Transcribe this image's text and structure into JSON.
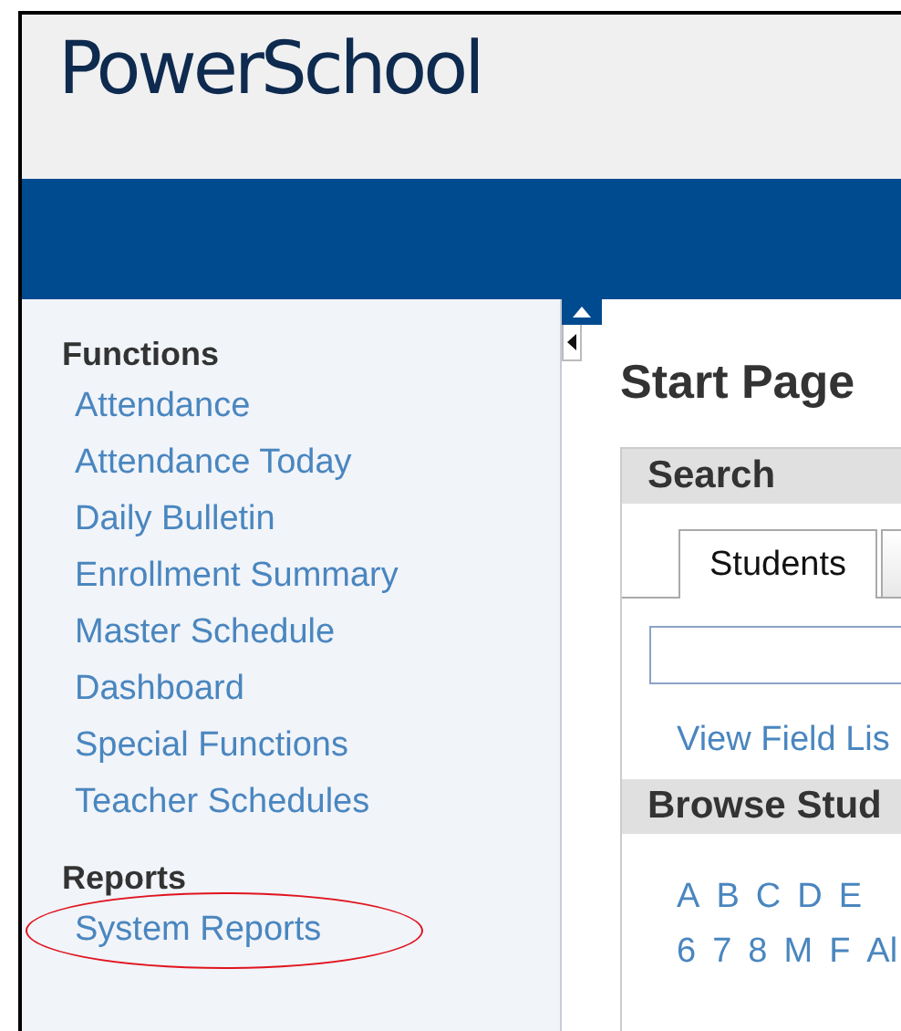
{
  "header": {
    "logo": "PowerSchool"
  },
  "sidebar": {
    "sections": [
      {
        "heading": "Functions",
        "items": [
          {
            "label": "Attendance",
            "circled": false
          },
          {
            "label": "Attendance Today",
            "circled": false
          },
          {
            "label": "Daily Bulletin",
            "circled": false
          },
          {
            "label": "Enrollment Summary",
            "circled": false
          },
          {
            "label": "Master Schedule",
            "circled": false
          },
          {
            "label": "Dashboard",
            "circled": false
          },
          {
            "label": "Special Functions",
            "circled": false
          },
          {
            "label": "Teacher Schedules",
            "circled": false
          }
        ]
      },
      {
        "heading": "Reports",
        "items": [
          {
            "label": "System Reports",
            "circled": true
          }
        ]
      }
    ]
  },
  "main": {
    "title": "Start Page",
    "search": {
      "heading": "Search",
      "tabs": [
        {
          "label": "Students",
          "selected": true
        },
        {
          "selected": false
        }
      ],
      "link": "View Field Lis"
    },
    "browse": {
      "heading": "Browse Stud",
      "rows": [
        [
          "A",
          "B",
          "C",
          "D",
          "E"
        ],
        [
          "6",
          "7",
          "8",
          "M",
          "F",
          "Al"
        ]
      ]
    }
  }
}
